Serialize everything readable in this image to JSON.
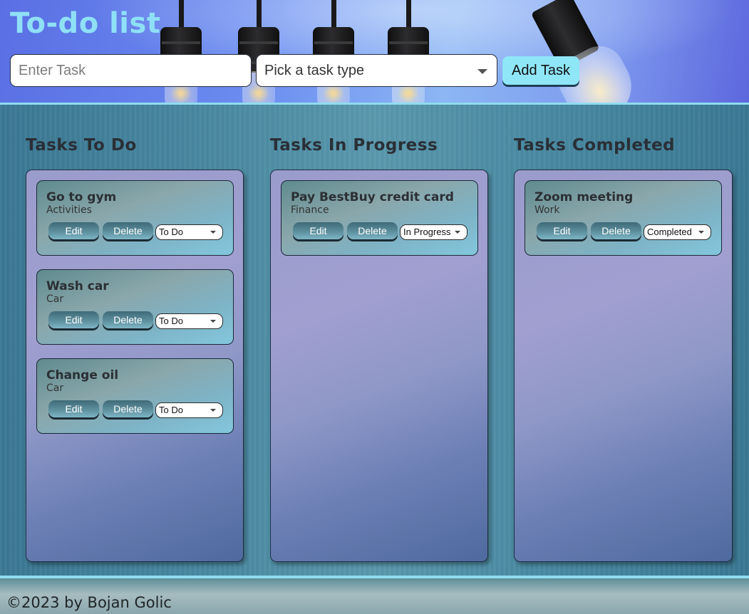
{
  "header": {
    "title": "To-do list",
    "task_placeholder": "Enter Task",
    "task_value": "",
    "type_select_value": "Pick a task type",
    "add_button_label": "Add Task"
  },
  "columns": [
    {
      "title": "Tasks To Do",
      "cards": [
        {
          "title": "Go to gym",
          "type": "Activities",
          "edit_label": "Edit",
          "delete_label": "Delete",
          "status": "To Do"
        },
        {
          "title": "Wash car",
          "type": "Car",
          "edit_label": "Edit",
          "delete_label": "Delete",
          "status": "To Do"
        },
        {
          "title": "Change oil",
          "type": "Car",
          "edit_label": "Edit",
          "delete_label": "Delete",
          "status": "To Do"
        }
      ]
    },
    {
      "title": "Tasks In Progress",
      "cards": [
        {
          "title": "Pay BestBuy credit card",
          "type": "Finance",
          "edit_label": "Edit",
          "delete_label": "Delete",
          "status": "In Progress"
        }
      ]
    },
    {
      "title": "Tasks Completed",
      "cards": [
        {
          "title": "Zoom meeting",
          "type": "Work",
          "edit_label": "Edit",
          "delete_label": "Delete",
          "status": "Completed"
        }
      ]
    }
  ],
  "footer": {
    "text": "©2023 by Bojan Golic"
  },
  "colors": {
    "accent": "#8fe6f7",
    "title_color": "#8fe0f6",
    "divider": "#8fdcef"
  },
  "icons": {
    "select_caret": "chevron-down-icon",
    "header_art": "light-bulb-icon"
  }
}
